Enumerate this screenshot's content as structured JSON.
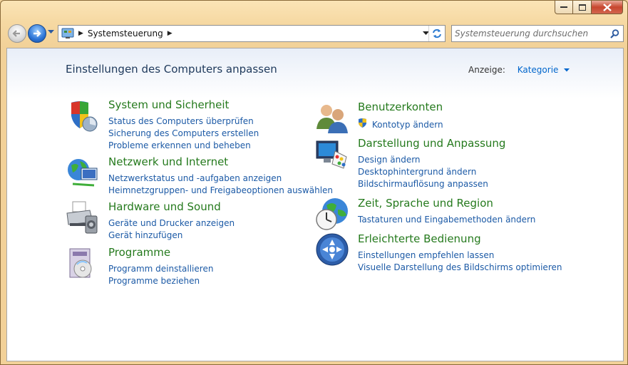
{
  "window": {
    "caption_buttons": [
      "minimize",
      "maximize",
      "close"
    ]
  },
  "nav": {
    "breadcrumb": [
      "Systemsteuerung"
    ],
    "search_placeholder": "Systemsteuerung durchsuchen"
  },
  "main": {
    "title": "Einstellungen des Computers anpassen",
    "view_label": "Anzeige:",
    "view_value": "Kategorie",
    "left": [
      {
        "icon": "security-shield-icon",
        "title": "System und Sicherheit",
        "links": [
          "Status des Computers überprüfen",
          "Sicherung des Computers erstellen",
          "Probleme erkennen und beheben"
        ]
      },
      {
        "icon": "network-globe-icon",
        "title": "Netzwerk und Internet",
        "links": [
          "Netzwerkstatus und -aufgaben anzeigen",
          "Heimnetzgruppen- und Freigabeoptionen auswählen"
        ]
      },
      {
        "icon": "printer-icon",
        "title": "Hardware und Sound",
        "links": [
          "Geräte und Drucker anzeigen",
          "Gerät hinzufügen"
        ]
      },
      {
        "icon": "programs-disc-icon",
        "title": "Programme",
        "links": [
          "Programm deinstallieren",
          "Programme beziehen"
        ]
      }
    ],
    "right": [
      {
        "icon": "users-icon",
        "title": "Benutzerkonten",
        "links": [
          "Kontotyp ändern"
        ]
      },
      {
        "icon": "monitor-palette-icon",
        "title": "Darstellung und Anpassung",
        "links": [
          "Design ändern",
          "Desktophintergrund ändern",
          "Bildschirmauflösung anpassen"
        ]
      },
      {
        "icon": "clock-globe-icon",
        "title": "Zeit, Sprache und Region",
        "links": [
          "Tastaturen und Eingabemethoden ändern"
        ]
      },
      {
        "icon": "ease-of-access-icon",
        "title": "Erleichterte Bedienung",
        "links": [
          "Einstellungen empfehlen lassen",
          "Visuelle Darstellung des Bildschirms optimieren"
        ]
      }
    ]
  },
  "colors": {
    "category_title": "#257a1d",
    "link": "#1c5aa6",
    "page_title": "#1e395b",
    "frame": "#f2d198"
  }
}
